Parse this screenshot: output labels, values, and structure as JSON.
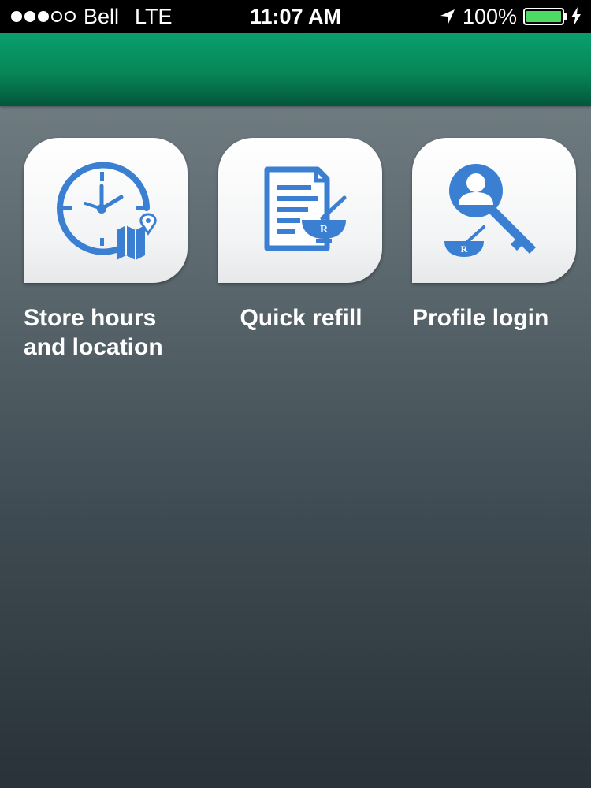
{
  "status_bar": {
    "signal_dots_filled": 3,
    "signal_dots_total": 5,
    "carrier": "Bell",
    "network": "LTE",
    "time": "11:07 AM",
    "battery_percent": "100%",
    "battery_level": 1.0,
    "battery_color": "#4cd964"
  },
  "header": {
    "color": "#078657"
  },
  "tiles": [
    {
      "label": "Store hours\nand location",
      "icon": "clock-map-icon"
    },
    {
      "label": "Quick refill",
      "icon": "prescription-document-icon"
    },
    {
      "label": "Profile login",
      "icon": "user-key-icon"
    }
  ],
  "accent_color": "#3a7fd1"
}
